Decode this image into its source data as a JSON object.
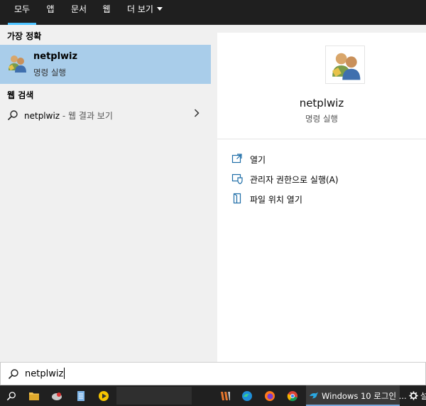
{
  "tabs": [
    {
      "label": "모두"
    },
    {
      "label": "앱"
    },
    {
      "label": "문서"
    },
    {
      "label": "웹"
    },
    {
      "label": "더 보기"
    }
  ],
  "left": {
    "best_match_title": "가장 정확",
    "best_match": {
      "name": "netplwiz",
      "type": "명령 실행"
    },
    "web_title": "웹 검색",
    "web_result": {
      "query": "netplwiz",
      "suffix": " - 웹 결과 보기"
    }
  },
  "right": {
    "app_name": "netplwiz",
    "app_type": "명령 실행",
    "actions": [
      {
        "label": "열기",
        "icon": "open-icon"
      },
      {
        "label": "관리자 권한으로 실행(A)",
        "icon": "shield-icon"
      },
      {
        "label": "파일 위치 열기",
        "icon": "file-location-icon"
      }
    ]
  },
  "search": {
    "value": "netplwiz"
  },
  "taskbar": {
    "active_window": "Windows 10 로그인 ...",
    "settings_label": "설"
  },
  "colors": {
    "selection": "#a9cdea",
    "accent": "#4cc2ff",
    "taskbar": "#202020"
  }
}
